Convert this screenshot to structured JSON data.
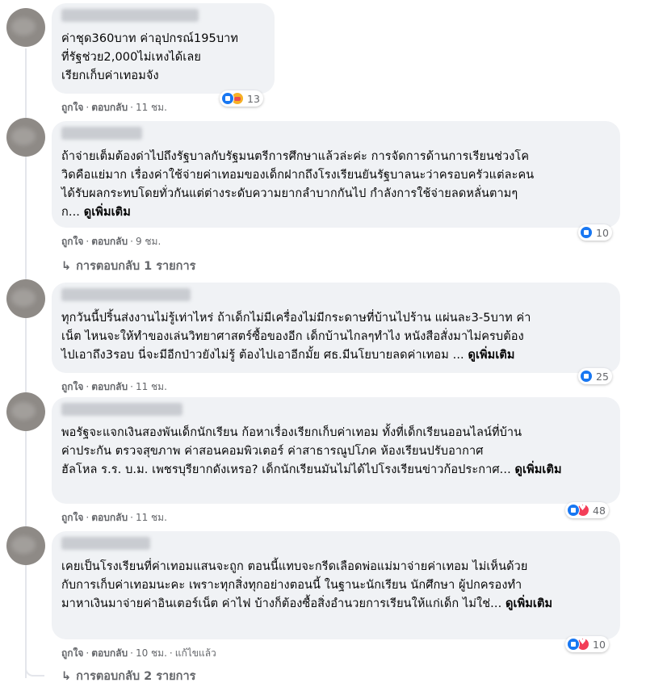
{
  "comments": [
    {
      "text": "ค่าชุด360บาท ค่าอุปกรณ์195บาท ที่รัฐช่วย2,000ไม่เหงได้เลย เรียกเก็บค่าเทอมจัง",
      "lines": [
        "ค่าชุด360บาท ค่าอุปกรณ์195บาท",
        "ที่รัฐช่วย2,000ไม่เหงได้เลย",
        "เรียกเก็บค่าเทอมจัง"
      ],
      "like": "ถูกใจ",
      "reply": "ตอบกลับ",
      "time": "11 ชม.",
      "reactions": [
        "like",
        "care"
      ],
      "reaction_count": "13"
    },
    {
      "lines": [
        "ถ้าจ่ายเต็มต้องด่าไปถึงรัฐบาลกับรัฐมนตรีการศึกษาแล้วล่ะค่ะ การจัดการด้านการเรียนช่วงโค",
        "วิดคือแย่มาก เรื่องค่าใช้จ่ายค่าเทอมของเด็กฝากถึงโรงเรียนยันรัฐบาลนะว่าครอบครัวแต่ละคน",
        "ได้รับผลกระทบโดยทั่วกันแต่ต่างระดับความยากลำบากกันไป กำลังการใช้จ่ายลดหลั่นตามๆ"
      ],
      "last_line": "ก...",
      "see_more": "ดูเพิ่มเติม",
      "like": "ถูกใจ",
      "reply": "ตอบกลับ",
      "time": "9 ชม.",
      "reactions": [
        "like"
      ],
      "reaction_count": "10",
      "replies_label": "การตอบกลับ 1 รายการ"
    },
    {
      "lines": [
        "ทุกวันนี้ปริ้นส่งงานไม่รู้เท่าไหร่ ถ้าเด็กไม่มีเครื่องไม่มีกระดาษที่บ้านไปร้าน แผ่นละ3-5บาท ค่า",
        "เน็ต ไหนจะให้ทำของเล่นวิทยาศาสตร์ซื้อของอีก เด็กบ้านไกลๆทำไง หนังสือสั่งมาไม่ครบต้อง"
      ],
      "last_line": "ไปเอาถึง3รอบ นี่จะมีอีกป่าวยังไม่รู้ ต้องไปเอาอีกมั้ย ศธ.มีนโยบายลดค่าเทอม ...",
      "see_more": "ดูเพิ่มเติม",
      "like": "ถูกใจ",
      "reply": "ตอบกลับ",
      "time": "11 ชม.",
      "reactions": [
        "like"
      ],
      "reaction_count": "25"
    },
    {
      "lines": [
        "พอรัฐจะแจกเงินสองพันเด็กนักเรียน ก้อหาเรื่องเรียกเก็บค่าเทอม ทั้งที่เด็กเรียนออนไลน์ที่บ้าน",
        "ค่าประกัน ตรวจสุขภาพ ค่าสอนคอมพิวเตอร์ ค่าสาธารณูปโภค ห้องเรียนปรับอากาศ"
      ],
      "last_line": "ฮัลโหล ร.ร. บ.ม. เพชรบุรียากดังเหรอ? เด็กนักเรียนมันไม่ได้ไปโรงเรียนข่าวก้อประกาศ...",
      "see_more": "ดูเพิ่มเติม",
      "like": "ถูกใจ",
      "reply": "ตอบกลับ",
      "time": "11 ชม.",
      "reactions": [
        "like",
        "love"
      ],
      "reaction_count": "48"
    },
    {
      "lines": [
        "เคยเป็นโรงเรียนที่ค่าเทอมแสนจะถูก ตอนนี้แทบจะกรีดเลือดพ่อแม่มาจ่ายค่าเทอม ไม่เห็นด้วย",
        "กับการเก็บค่าเทอมนะคะ เพราะทุกสิ่งทุกอย่างตอนนี้ ในฐานะนักเรียน นักศึกษา ผู้ปกครองทำ"
      ],
      "last_line": "มาหาเงินมาจ่ายค่าอินเตอร์เน็ต ค่าไฟ บ้างก็ต้องซื้อสิ่งอำนวยการเรียนให้แก่เด็ก ไม่ใช่...",
      "see_more": "ดูเพิ่มเติม",
      "like": "ถูกใจ",
      "reply": "ตอบกลับ",
      "time": "10 ชม.",
      "edited": "แก้ไขแล้ว",
      "reactions": [
        "like",
        "love"
      ],
      "reaction_count": "10",
      "replies_label": "การตอบกลับ 2 รายการ"
    }
  ],
  "colors": {
    "bubble": "#f0f2f5",
    "meta": "#65676b",
    "like": "#1877f2",
    "love": "#f33e58",
    "care": "#f7b125"
  }
}
